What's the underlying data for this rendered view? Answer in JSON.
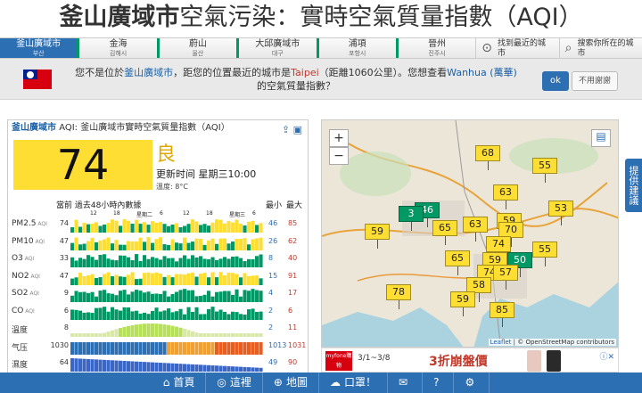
{
  "page_title_bold": "釜山廣域市",
  "page_title_rest": "空氣污染：實時空氣質量指數（AQI）",
  "cities": [
    {
      "name": "釜山廣域市",
      "sub": "부산"
    },
    {
      "name": "金海",
      "sub": "김해시"
    },
    {
      "name": "蔚山",
      "sub": "울산"
    },
    {
      "name": "大邱廣域市",
      "sub": "대구"
    },
    {
      "name": "浦項",
      "sub": "포항시"
    },
    {
      "name": "晉州",
      "sub": "진주시"
    }
  ],
  "nearest_label": "找到最近的城市",
  "search_label": "搜索你所在的城市",
  "notice": {
    "line1_a": "您不是位於",
    "line1_city": "釜山廣域市",
    "line1_b": "，距您的位置最近的城市是",
    "line1_near": "Taipei",
    "line1_c": "（距離1060公里）。您想查看",
    "line1_alt": "Wanhua (萬華)",
    "line2": "的空氣質量指數？",
    "ok": "ok",
    "no": "不用謝謝"
  },
  "panel": {
    "city": "釜山廣域市",
    "header_rest": "AQI: 釜山廣域市實時空氣質量指數（AQI）",
    "aqi": "74",
    "level": "良",
    "updated": "更新时间 星期三10:00",
    "temp": "溫度: 8°C",
    "col_current": "當前 過去48小時內數據",
    "col_min": "最小",
    "col_max": "最大",
    "tick_labels": [
      "12",
      "18",
      "星期二",
      "6",
      "12",
      "18",
      "星期三",
      "6"
    ],
    "rows": [
      {
        "name": "PM2.5",
        "unit": "AQI",
        "cur": "74",
        "min": "46",
        "max": "85",
        "kind": "aqi"
      },
      {
        "name": "PM10",
        "unit": "AQI",
        "cur": "47",
        "min": "26",
        "max": "62",
        "kind": "aqi"
      },
      {
        "name": "O3",
        "unit": "AQI",
        "cur": "33",
        "min": "8",
        "max": "40",
        "kind": "green"
      },
      {
        "name": "NO2",
        "unit": "AQI",
        "cur": "47",
        "min": "15",
        "max": "91",
        "kind": "aqi"
      },
      {
        "name": "SO2",
        "unit": "AQI",
        "cur": "9",
        "min": "4",
        "max": "17",
        "kind": "green"
      },
      {
        "name": "CO",
        "unit": "AQI",
        "cur": "6",
        "min": "2",
        "max": "6",
        "kind": "green"
      },
      {
        "name": "溫度",
        "unit": "",
        "cur": "8",
        "min": "2",
        "max": "11",
        "kind": "temp"
      },
      {
        "name": "气压",
        "unit": "",
        "cur": "1030",
        "min": "1013",
        "max": "1031",
        "kind": "press"
      },
      {
        "name": "濕度",
        "unit": "",
        "cur": "64",
        "min": "49",
        "max": "90",
        "kind": "hum"
      },
      {
        "name": "風速",
        "unit": "",
        "cur": "6",
        "min": "3",
        "max": "7",
        "kind": "wind"
      }
    ]
  },
  "map": {
    "zoom_in": "+",
    "zoom_out": "−",
    "markers": [
      {
        "v": "68",
        "color": "yellow"
      },
      {
        "v": "55",
        "color": "yellow"
      },
      {
        "v": "63",
        "color": "yellow"
      },
      {
        "v": "53",
        "color": "yellow"
      },
      {
        "v": "46",
        "color": "green"
      },
      {
        "v": "3",
        "color": "green"
      },
      {
        "v": "59",
        "color": "yellow"
      },
      {
        "v": "65",
        "color": "yellow"
      },
      {
        "v": "63",
        "color": "yellow"
      },
      {
        "v": "59",
        "color": "yellow"
      },
      {
        "v": "70",
        "color": "yellow"
      },
      {
        "v": "74",
        "color": "yellow"
      },
      {
        "v": "55",
        "color": "yellow"
      },
      {
        "v": "65",
        "color": "yellow"
      },
      {
        "v": "59",
        "color": "yellow"
      },
      {
        "v": "50",
        "color": "green"
      },
      {
        "v": "74",
        "color": "yellow"
      },
      {
        "v": "57",
        "color": "yellow"
      },
      {
        "v": "78",
        "color": "yellow"
      },
      {
        "v": "58",
        "color": "yellow"
      },
      {
        "v": "59",
        "color": "yellow"
      },
      {
        "v": "85",
        "color": "yellow"
      }
    ],
    "attrib_leaflet": "Leaflet",
    "attrib_rest": " | © OpenStreetMap contributors"
  },
  "ad": {
    "brand": "myfone購物",
    "date": "3/1~3/8",
    "promo": "3折崩盤價"
  },
  "side_tab": "提供建議",
  "bottom": [
    {
      "label": "首頁",
      "icon": "⌂"
    },
    {
      "label": "這裡",
      "icon": "◎"
    },
    {
      "label": "地圖",
      "icon": "⊕"
    },
    {
      "label": "口罩！",
      "icon": "☁"
    },
    {
      "label": "",
      "icon": "✉"
    },
    {
      "label": "",
      "icon": "?"
    },
    {
      "label": "",
      "icon": "⚙"
    }
  ]
}
